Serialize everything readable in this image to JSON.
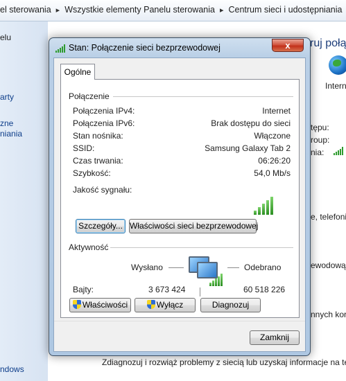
{
  "background": {
    "breadcrumb": [
      "el sterowania",
      "Wszystkie elementy Panelu sterowania",
      "Centrum sieci i udostępniania"
    ],
    "sidebar": [
      "elu",
      "arty",
      "zne",
      "niania",
      "ndows"
    ],
    "title": "ruj połą",
    "icon_label": "Intern",
    "props": [
      "tępu:",
      "roup:",
      "nia:"
    ],
    "texts": [
      "e, telefoni",
      "ewodową, ",
      "nnych kor"
    ],
    "footer": "Zdiagnozuj i rozwiąż problemy z siecią lub uzyskaj informacje na te"
  },
  "dialog": {
    "title": "Stan: Połączenie sieci bezprzewodowej",
    "close": "x",
    "tab": "Ogólne",
    "connection": {
      "label": "Połączenie",
      "rows": [
        {
          "label": "Połączenia IPv4:",
          "value": "Internet"
        },
        {
          "label": "Połączenia IPv6:",
          "value": "Brak dostępu do sieci"
        },
        {
          "label": "Stan nośnika:",
          "value": "Włączone"
        },
        {
          "label": "SSID:",
          "value": "Samsung Galaxy Tab 2"
        },
        {
          "label": "Czas trwania:",
          "value": "06:26:20"
        },
        {
          "label": "Szybkość:",
          "value": "54,0 Mb/s"
        }
      ],
      "signal_label": "Jakość sygnału:",
      "signal_bars": 5,
      "details_button": "Szczegóły...",
      "wireless_props_button": "Właściwości sieci bezprzewodowej"
    },
    "activity": {
      "label": "Aktywność",
      "sent_label": "Wysłano",
      "received_label": "Odebrano",
      "bytes_label": "Bajty:",
      "sent_bytes": "3 673 424",
      "received_bytes": "60 518 226"
    },
    "buttons": {
      "properties": "Właściwości",
      "disable": "Wyłącz",
      "diagnose": "Diagnozuj",
      "close": "Zamknij"
    }
  }
}
